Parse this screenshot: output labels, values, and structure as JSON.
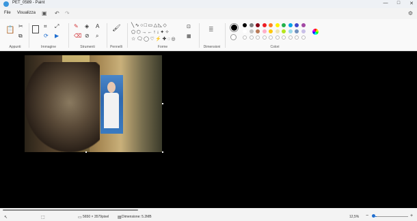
{
  "window": {
    "title": "PET_0589 - Paint",
    "controls": [
      "—",
      "□",
      "✕"
    ]
  },
  "menu": {
    "file": "File",
    "view": "Visualizza"
  },
  "ribbon": {
    "groups": {
      "clipboard": "Appunti",
      "image": "Immagine",
      "tools": "Strumenti",
      "brushes": "Pennelli",
      "shapes": "Forme",
      "size": "Dimensioni",
      "colors": "Colori"
    }
  },
  "palette": {
    "primary": "#000000",
    "secondary": "#ffffff",
    "row1": [
      "#000000",
      "#7f7f7f",
      "#880015",
      "#ed1c24",
      "#ff7f27",
      "#fff200",
      "#22b14c",
      "#00a2e8",
      "#3f48cc",
      "#a349a4"
    ],
    "row2": [
      "#ffffff",
      "#c3c3c3",
      "#b97a57",
      "#ffaec9",
      "#ffc90e",
      "#efe4b0",
      "#b5e61d",
      "#99d9ea",
      "#7092be",
      "#c8bfe7"
    ]
  },
  "status": {
    "dimensions": "5650 × 3579pixel",
    "size": "Dimensione: 5.2MB",
    "zoom": "12,5%",
    "zoom_minus": "−",
    "zoom_plus": "+"
  }
}
